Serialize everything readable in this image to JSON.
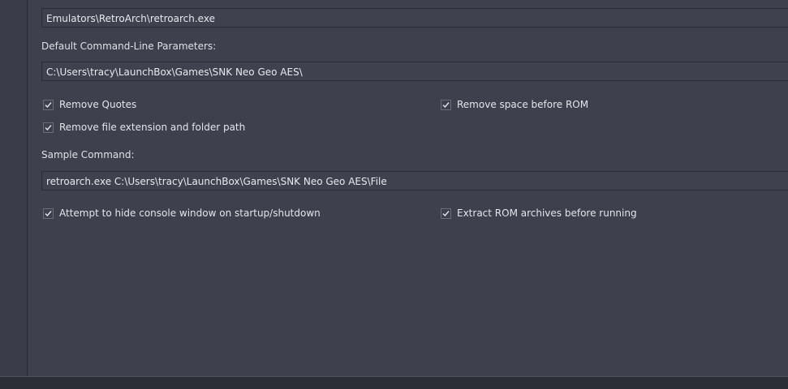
{
  "emulator_path": {
    "value": "Emulators\\RetroArch\\retroarch.exe"
  },
  "command_line": {
    "label": "Default Command-Line Parameters:",
    "value": "C:\\Users\\tracy\\LaunchBox\\Games\\SNK Neo Geo AES\\"
  },
  "options": {
    "remove_quotes": {
      "label": "Remove Quotes",
      "checked": true
    },
    "remove_space_before_rom": {
      "label": "Remove space before ROM",
      "checked": true
    },
    "remove_file_extension": {
      "label": "Remove file extension and folder path",
      "checked": true
    },
    "hide_console": {
      "label": "Attempt to hide console window on startup/shutdown",
      "checked": true
    },
    "extract_rom": {
      "label": "Extract ROM archives before running",
      "checked": true
    }
  },
  "sample_command": {
    "label": "Sample Command:",
    "value": "retroarch.exe C:\\Users\\tracy\\LaunchBox\\Games\\SNK Neo Geo AES\\File"
  },
  "icons": {
    "check": "checkmark-icon"
  }
}
